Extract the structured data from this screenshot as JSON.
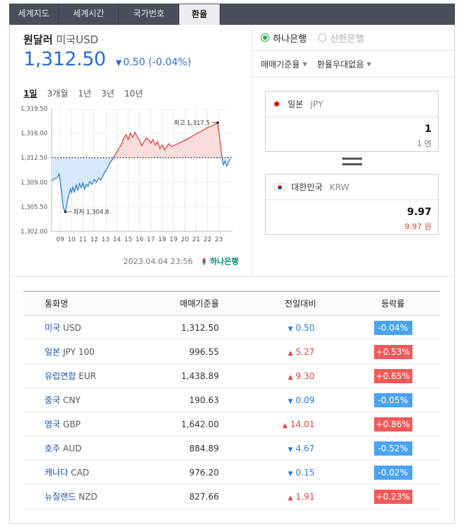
{
  "tabs": [
    {
      "label": "세계지도",
      "active": false
    },
    {
      "label": "세계시간",
      "active": false
    },
    {
      "label": "국가번호",
      "active": false
    },
    {
      "label": "환율",
      "active": true
    }
  ],
  "header": {
    "title_main": "원달러",
    "title_sub": "미국USD",
    "rate": "1,312.50",
    "change_icon": "triangle-down-icon",
    "change": "0.50 (-0.04%)"
  },
  "periods": [
    "1일",
    "3개월",
    "1년",
    "3년",
    "10년"
  ],
  "active_period": "1일",
  "chart_data": {
    "type": "line",
    "ylim": [
      1302.0,
      1319.5
    ],
    "yticks": [
      "1,319.50",
      "1,316.00",
      "1,312.50",
      "1,309.00",
      "1,305.50",
      "1,302.00"
    ],
    "xticks": [
      "09",
      "10",
      "11",
      "12",
      "13",
      "14",
      "15",
      "16",
      "17",
      "18",
      "19",
      "20",
      "21",
      "22",
      "23"
    ],
    "baseline": 1312.5,
    "max_label": "최고 1,317.5",
    "min_label": "최저 1,304.8",
    "colors": {
      "up": "#e0463c",
      "down": "#2a7ed6",
      "up_fill": "#fbdcdc",
      "down_fill": "#d8e9fb"
    },
    "series": [
      {
        "values": [
          [
            8.25,
            1309.2
          ],
          [
            8.5,
            1309.5
          ],
          [
            8.75,
            1309.7
          ],
          [
            8.9,
            1310.2
          ],
          [
            9.0,
            1309.2
          ],
          [
            9.1,
            1307.8
          ],
          [
            9.2,
            1306.2
          ],
          [
            9.3,
            1305.2
          ],
          [
            9.45,
            1304.8
          ],
          [
            9.6,
            1306.0
          ],
          [
            9.75,
            1307.2
          ],
          [
            9.9,
            1308.0
          ],
          [
            10.0,
            1307.5
          ],
          [
            10.1,
            1308.3
          ],
          [
            10.25,
            1307.6
          ],
          [
            10.4,
            1308.6
          ],
          [
            10.55,
            1307.9
          ],
          [
            10.7,
            1308.8
          ],
          [
            10.85,
            1308.2
          ],
          [
            11.0,
            1308.9
          ],
          [
            11.15,
            1308.0
          ],
          [
            11.3,
            1308.7
          ],
          [
            11.45,
            1308.4
          ],
          [
            11.6,
            1309.1
          ],
          [
            11.8,
            1308.7
          ],
          [
            12.0,
            1309.4
          ],
          [
            12.2,
            1309.0
          ],
          [
            12.4,
            1309.6
          ],
          [
            12.6,
            1309.3
          ],
          [
            12.8,
            1310.0
          ],
          [
            13.0,
            1310.6
          ],
          [
            13.2,
            1311.1
          ],
          [
            13.4,
            1311.8
          ],
          [
            13.6,
            1312.2
          ],
          [
            13.8,
            1312.8
          ],
          [
            14.0,
            1313.3
          ],
          [
            14.2,
            1313.9
          ],
          [
            14.4,
            1314.4
          ],
          [
            14.6,
            1315.2
          ],
          [
            14.8,
            1315.8
          ],
          [
            15.0,
            1315.1
          ],
          [
            15.2,
            1316.0
          ],
          [
            15.4,
            1315.4
          ],
          [
            15.6,
            1316.1
          ],
          [
            15.8,
            1315.5
          ],
          [
            16.0,
            1315.0
          ],
          [
            16.2,
            1314.2
          ],
          [
            16.4,
            1314.8
          ],
          [
            16.6,
            1315.3
          ],
          [
            16.8,
            1315.0
          ],
          [
            17.0,
            1314.6
          ],
          [
            17.2,
            1315.1
          ],
          [
            17.4,
            1314.3
          ],
          [
            17.6,
            1314.8
          ],
          [
            17.8,
            1313.8
          ],
          [
            18.0,
            1314.3
          ],
          [
            18.2,
            1313.6
          ],
          [
            18.4,
            1314.1
          ],
          [
            18.6,
            1314.5
          ],
          [
            18.8,
            1314.1
          ],
          [
            19.0,
            1314.2
          ],
          [
            19.5,
            1314.6
          ],
          [
            20.0,
            1315.0
          ],
          [
            20.5,
            1315.4
          ],
          [
            21.0,
            1315.9
          ],
          [
            21.5,
            1316.3
          ],
          [
            22.0,
            1316.8
          ],
          [
            22.5,
            1317.1
          ],
          [
            22.9,
            1317.5
          ],
          [
            23.1,
            1315.0
          ],
          [
            23.25,
            1312.8
          ],
          [
            23.4,
            1311.5
          ],
          [
            23.55,
            1312.0
          ],
          [
            23.7,
            1311.3
          ],
          [
            23.85,
            1311.8
          ],
          [
            24.0,
            1312.3
          ]
        ]
      }
    ]
  },
  "chart_footer": {
    "timestamp": "2023.04.04  23:56",
    "bank_logo": "하나은행",
    "logo_icon": "hana-bank-logo-icon"
  },
  "banks": [
    {
      "label": "하나은행",
      "selected": true
    },
    {
      "label": "신한은행",
      "selected": false
    }
  ],
  "dropdowns": [
    {
      "label": "매매기준율",
      "icon": "caret-down-icon"
    },
    {
      "label": "환율우대없음",
      "icon": "caret-down-icon"
    }
  ],
  "converter": {
    "from": {
      "country": "일본",
      "code": "JPY",
      "flag": "japan-flag-icon",
      "amount": "1",
      "unit": "1 엔"
    },
    "to": {
      "country": "대한민국",
      "code": "KRW",
      "flag": "korea-flag-icon",
      "amount": "9.97",
      "unit": "9.97 원"
    },
    "equals_icon": "equals-icon"
  },
  "table": {
    "headers": [
      "통화명",
      "매매기준율",
      "전일대비",
      "등락률"
    ],
    "rows": [
      {
        "country": "미국",
        "code": "USD",
        "rate": "1,312.50",
        "dir": "down",
        "change": "0.50",
        "pct": "-0.04%"
      },
      {
        "country": "일본",
        "code": "JPY 100",
        "rate": "996.55",
        "dir": "up",
        "change": "5.27",
        "pct": "+0.53%"
      },
      {
        "country": "유럽연합",
        "code": "EUR",
        "rate": "1,438.89",
        "dir": "up",
        "change": "9.30",
        "pct": "+0.65%"
      },
      {
        "country": "중국",
        "code": "CNY",
        "rate": "190.63",
        "dir": "down",
        "change": "0.09",
        "pct": "-0.05%"
      },
      {
        "country": "영국",
        "code": "GBP",
        "rate": "1,642.00",
        "dir": "up",
        "change": "14.01",
        "pct": "+0.86%"
      },
      {
        "country": "호주",
        "code": "AUD",
        "rate": "884.89",
        "dir": "down",
        "change": "4.67",
        "pct": "-0.52%"
      },
      {
        "country": "캐나다",
        "code": "CAD",
        "rate": "976.20",
        "dir": "down",
        "change": "0.15",
        "pct": "-0.02%"
      },
      {
        "country": "뉴질랜드",
        "code": "NZD",
        "rate": "827.66",
        "dir": "up",
        "change": "1.91",
        "pct": "+0.23%"
      }
    ]
  }
}
